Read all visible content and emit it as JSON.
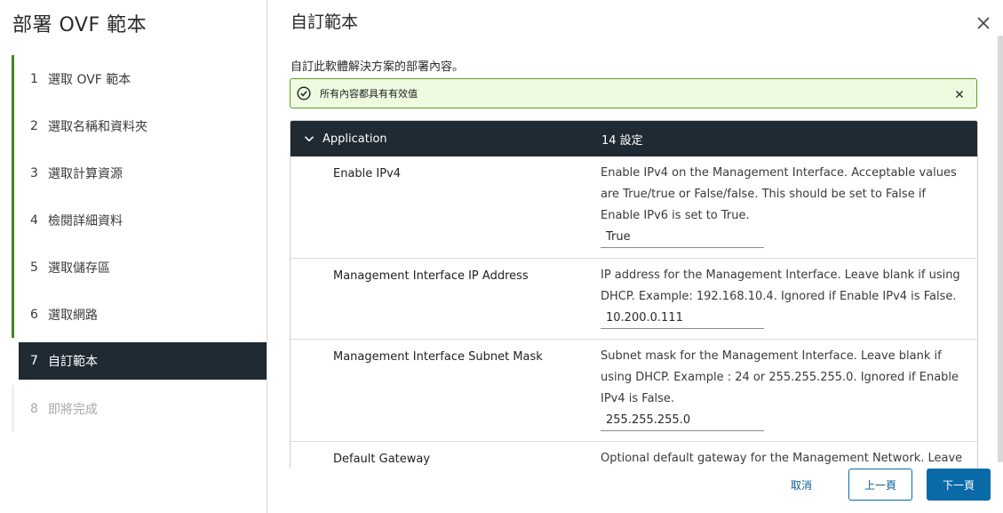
{
  "wizard": {
    "title": "部署 OVF 範本"
  },
  "steps": [
    {
      "num": "1",
      "label": "選取 OVF 範本",
      "state": "done"
    },
    {
      "num": "2",
      "label": "選取名稱和資料夾",
      "state": "done"
    },
    {
      "num": "3",
      "label": "選取計算資源",
      "state": "done"
    },
    {
      "num": "4",
      "label": "檢閱詳細資料",
      "state": "done"
    },
    {
      "num": "5",
      "label": "選取儲存區",
      "state": "done"
    },
    {
      "num": "6",
      "label": "選取網路",
      "state": "done"
    },
    {
      "num": "7",
      "label": "自訂範本",
      "state": "active"
    },
    {
      "num": "8",
      "label": "即將完成",
      "state": "future"
    }
  ],
  "main": {
    "title": "自訂範本",
    "description": "自訂此軟體解決方案的部署內容。",
    "alert": {
      "text": "所有內容都具有有效值",
      "type": "success"
    },
    "group": {
      "name": "Application",
      "count": "14 設定"
    },
    "properties": [
      {
        "label": "Enable IPv4",
        "description": "Enable IPv4 on the Management Interface. Acceptable values are True/true or False/false. This should be set to False if Enable IPv6 is set to True.",
        "value": "True"
      },
      {
        "label": "Management Interface IP Address",
        "description": "IP address for the Management Interface. Leave blank if using DHCP. Example: 192.168.10.4. Ignored if Enable IPv4 is False.",
        "value": "10.200.0.111"
      },
      {
        "label": "Management Interface Subnet Mask",
        "description": "Subnet mask for the Management Interface. Leave blank if using DHCP. Example : 24 or 255.255.255.0. Ignored if Enable IPv4 is False.",
        "value": "255.255.255.0"
      },
      {
        "label": "Default Gateway",
        "description": "Optional default gateway for the Management Network. Leave",
        "value": ""
      }
    ]
  },
  "footer": {
    "cancel": "取消",
    "back": "上一頁",
    "next": "下一頁"
  },
  "colors": {
    "accent": "#0a6aa8",
    "success": "#5aa220",
    "dark": "#1f2a33",
    "done_bar": "#3e8a1e"
  }
}
